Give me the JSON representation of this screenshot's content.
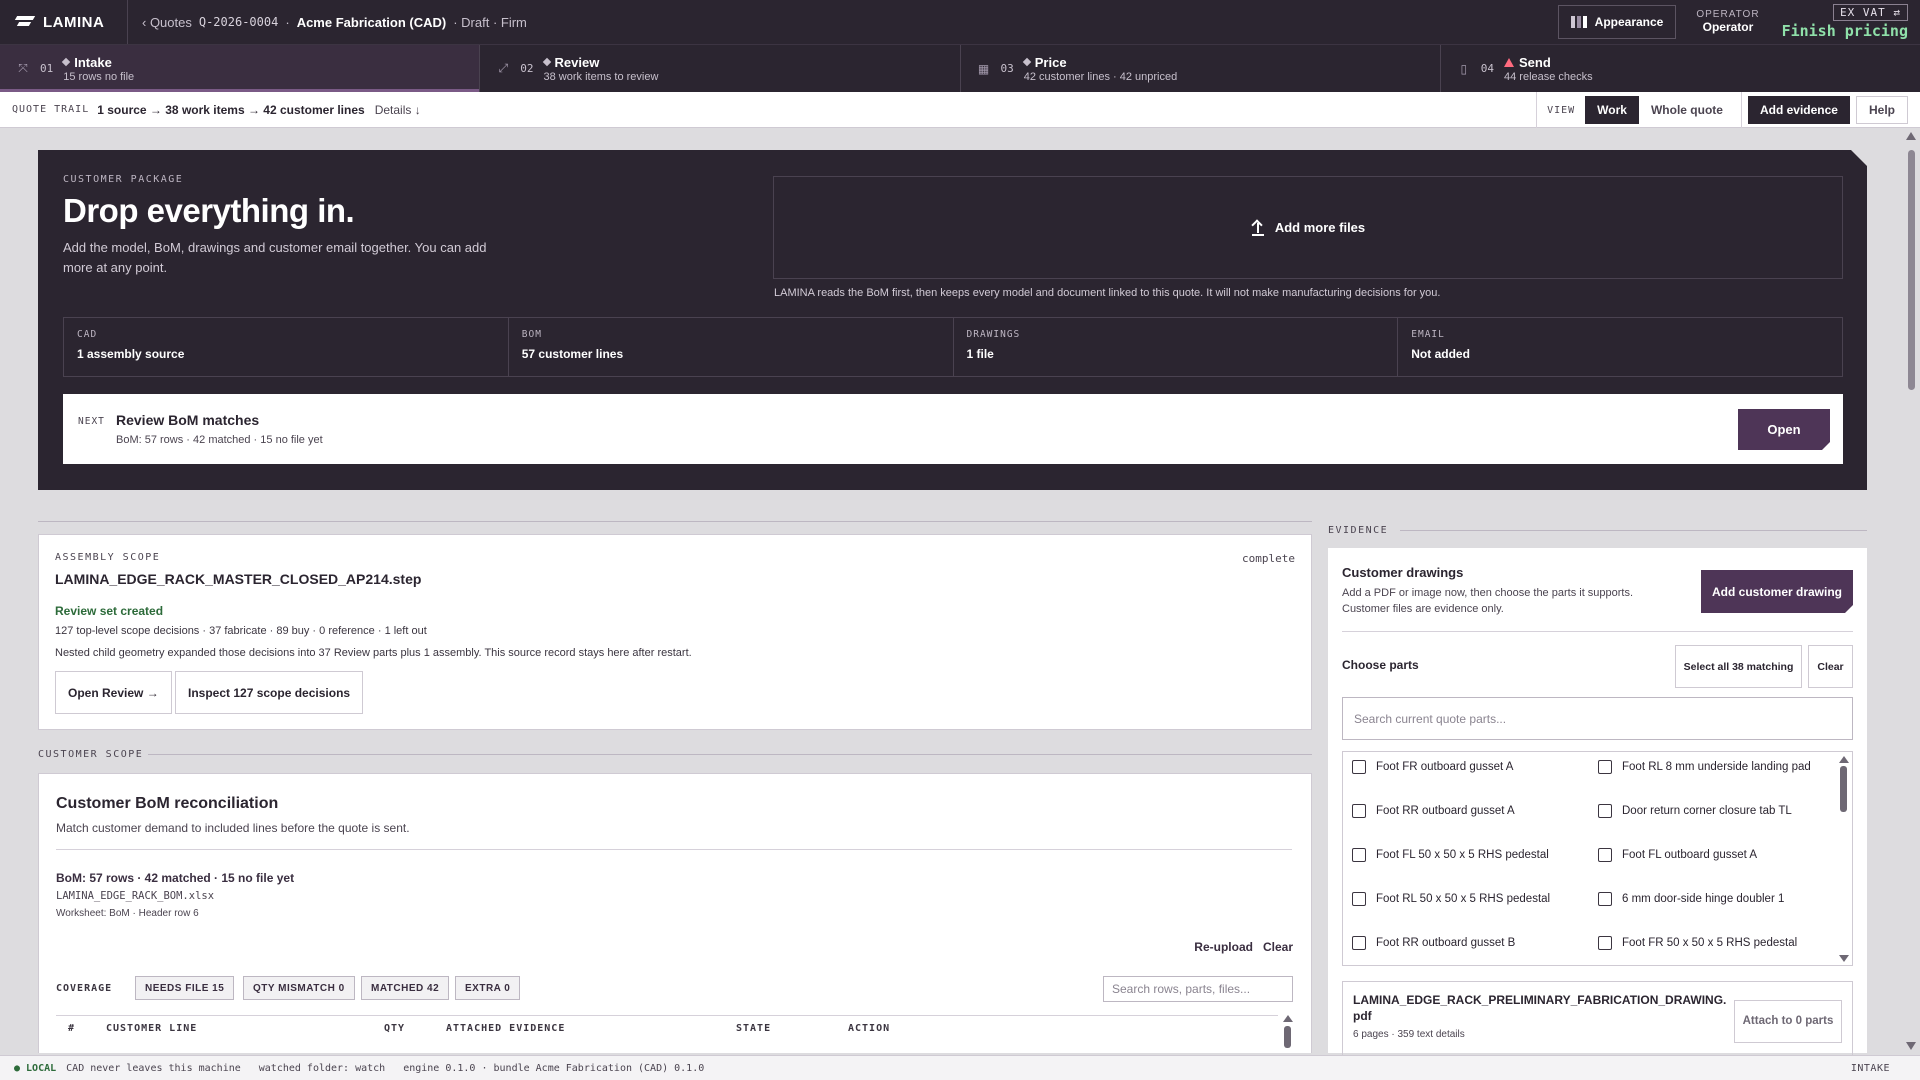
{
  "app": {
    "brand": "LAMINA"
  },
  "breadcrumb": {
    "back": "‹ Quotes",
    "quote_id": "Q-2026-0004",
    "customer": "Acme Fabrication (CAD)",
    "status": "· Draft · Firm"
  },
  "header": {
    "appearance": "Appearance",
    "operator_label": "OPERATOR",
    "operator_value": "Operator",
    "ex_vat": "EX VAT ⇄",
    "finish": "Finish pricing"
  },
  "steps": [
    {
      "num": "01",
      "title": "Intake",
      "sub": "15 rows no file",
      "icon": "intake-icon",
      "marker": "diamond"
    },
    {
      "num": "02",
      "title": "Review",
      "sub": "38 work items to review",
      "icon": "review-icon",
      "marker": "diamond"
    },
    {
      "num": "03",
      "title": "Price",
      "sub": "42 customer lines · 42 unpriced",
      "icon": "calculator-icon",
      "marker": "diamond"
    },
    {
      "num": "04",
      "title": "Send",
      "sub": "44 release checks",
      "icon": "document-icon",
      "marker": "warning"
    }
  ],
  "trail": {
    "label": "QUOTE TRAIL",
    "text": "1 source → 38 work items → 42 customer lines",
    "details": "Details ↓",
    "view_label": "VIEW",
    "work": "Work",
    "whole": "Whole quote",
    "add_evidence": "Add evidence",
    "help": "Help"
  },
  "hero": {
    "kicker": "CUSTOMER PACKAGE",
    "title": "Drop everything in.",
    "desc": "Add the model, BoM, drawings and customer email together. You can add more at any point.",
    "add_files": "Add more files",
    "note": "LAMINA reads the BoM first, then keeps every model and document linked to this quote. It will not make manufacturing decisions for you.",
    "stats": [
      {
        "label": "CAD",
        "value": "1 assembly source"
      },
      {
        "label": "BOM",
        "value": "57 customer lines"
      },
      {
        "label": "DRAWINGS",
        "value": "1 file"
      },
      {
        "label": "EMAIL",
        "value": "Not added"
      }
    ],
    "next": {
      "label": "NEXT",
      "title": "Review BoM matches",
      "sub": "BoM: 57 rows · 42 matched · 15 no file yet",
      "open": "Open"
    }
  },
  "assembly": {
    "kicker": "ASSEMBLY SCOPE",
    "status": "complete",
    "file": "LAMINA_EDGE_RACK_MASTER_CLOSED_AP214.step",
    "created": "Review set created",
    "stats": "127 top-level scope decisions · 37 fabricate · 89 buy · 0 reference · 1 left out",
    "note": "Nested child geometry expanded those decisions into 37 Review parts plus 1 assembly. This source record stays here after restart.",
    "open_review": "Open Review →",
    "inspect": "Inspect 127 scope decisions"
  },
  "customer_scope": {
    "label": "CUSTOMER SCOPE",
    "title": "Customer BoM reconciliation",
    "sub": "Match customer demand to included lines before the quote is sent.",
    "bom_line": "BoM: 57 rows · 42 matched · 15 no file yet",
    "file": "LAMINA_EDGE_RACK_BOM.xlsx",
    "sheet": "Worksheet: BoM · Header row 6",
    "reupload": "Re-upload",
    "clear": "Clear",
    "coverage": "COVERAGE",
    "chips": [
      "NEEDS FILE 15",
      "QTY MISMATCH 0",
      "MATCHED 42",
      "EXTRA 0"
    ],
    "search_placeholder": "Search rows, parts, files...",
    "columns": [
      "#",
      "CUSTOMER LINE",
      "QTY",
      "ATTACHED EVIDENCE",
      "STATE",
      "ACTION"
    ]
  },
  "evidence": {
    "label": "EVIDENCE",
    "title": "Customer drawings",
    "sub": "Add a PDF or image now, then choose the parts it supports. Customer files are evidence only.",
    "add_drawing": "Add customer drawing",
    "choose": "Choose parts",
    "select_all": "Select all 38 matching",
    "clear": "Clear",
    "search_placeholder": "Search current quote parts...",
    "parts": [
      "Foot FR outboard gusset A",
      "Foot RL 8 mm underside landing pad",
      "Foot RR outboard gusset A",
      "Door return corner closure tab TL",
      "Foot FL 50 x 50 x 5 RHS pedestal",
      "Foot FL outboard gusset A",
      "Foot RL 50 x 50 x 5 RHS pedestal",
      "6 mm door-side hinge doubler 1",
      "Foot RR outboard gusset B",
      "Foot FR 50 x 50 x 5 RHS pedestal"
    ],
    "file": {
      "name": "LAMINA_EDGE_RACK_PRELIMINARY_FABRICATION_DRAWING.pdf",
      "meta": "6 pages · 359 text details",
      "attach": "Attach to 0 parts"
    }
  },
  "status_bar": {
    "local": "● LOCAL",
    "cad": "CAD never leaves this machine",
    "folder": "watched folder: watch",
    "engine": "engine 0.1.0 · bundle Acme Fabrication (CAD) 0.1.0",
    "stage": "INTAKE"
  }
}
